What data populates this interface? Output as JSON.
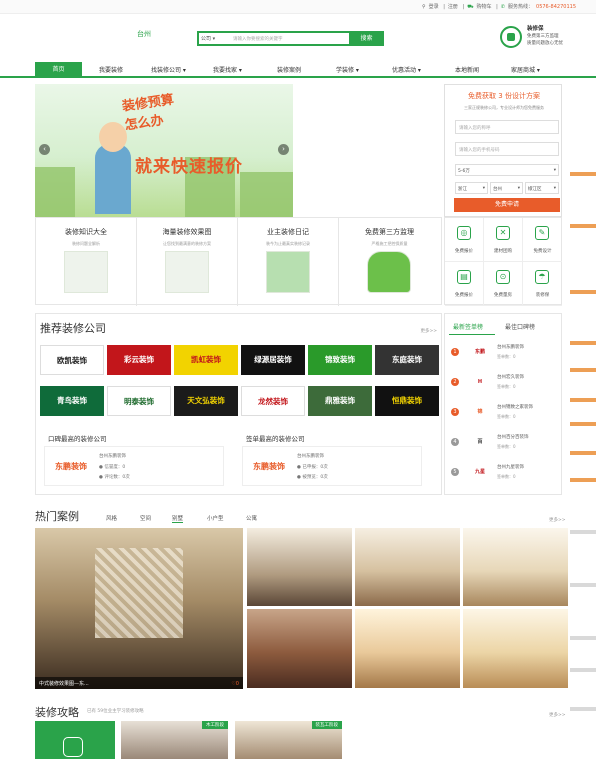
{
  "topbar": {
    "login": "登录",
    "register": "注册",
    "cart": "购物车",
    "hotline_label": "服务热线：",
    "phone": "0576-84270115"
  },
  "header": {
    "city": "台州",
    "search": {
      "scope": "公司",
      "placeholder": "请输入你要搜索的关键字",
      "button": "搜索"
    },
    "guarantee": {
      "title": "装修保",
      "line1": "免费第三方监理",
      "line2": "质量问题放心无忧"
    }
  },
  "nav": {
    "items": [
      "首页",
      "我要装修",
      "找装修公司",
      "我要找家",
      "装修案例",
      "学装修",
      "优惠活动",
      "本地新闻",
      "家居商城"
    ]
  },
  "banner": {
    "line1": "装修预算",
    "line2": "怎么办",
    "headline": "就来快速报价",
    "prev": "‹",
    "next": "›"
  },
  "quote_form": {
    "title": "免费获取 3 份设计方案",
    "subtitle": "三家正规装修公司，专业设计师为您免费服务",
    "name_ph": "请输入您的称呼",
    "phone_ph": "请输入您的手机号码",
    "area": "5-6万",
    "province": "浙江",
    "city": "台州",
    "district": "椒江区",
    "button": "免费申请"
  },
  "features": [
    {
      "title": "装修知识大全",
      "sub": "装修问题全解析"
    },
    {
      "title": "海量装修效果图",
      "sub": "让您找到最满意的装修方案"
    },
    {
      "title": "业主装修日记",
      "sub": "装今为止最真实装修记录"
    },
    {
      "title": "免费第三方监理",
      "sub": "严格施工把控保质量"
    }
  ],
  "tools": [
    {
      "label": "免费报价",
      "icon": "▢"
    },
    {
      "label": "建材团购",
      "icon": "▢"
    },
    {
      "label": "免费设计",
      "icon": "▢"
    },
    {
      "label": "免费报价",
      "icon": "▢"
    },
    {
      "label": "免费量房",
      "icon": "▢"
    },
    {
      "label": "装修保",
      "icon": "▢"
    }
  ],
  "recommend": {
    "title": "推荐装修公司",
    "more": "更多>>",
    "logos": [
      "欧凯装饰",
      "彩云装饰",
      "凯虹装饰",
      "绿源居装饰",
      "锦致装饰",
      "东庭装饰",
      "青鸟装饰",
      "明泰装饰",
      "天文弘装饰",
      "龙然装饰",
      "鼎雅装饰",
      "恒鼎装饰"
    ],
    "praise_title": "口碑最高的装修公司",
    "orders_title": "签单最高的装修公司",
    "praise": {
      "logo": "东鹏装饰",
      "name": "台州东鹏装饰",
      "l1": "● 信誉度：0",
      "l2": "● 评论数：0次"
    },
    "orders": {
      "logo": "东鹏装饰",
      "name": "台州东鹏装饰",
      "l1": "● 已申报：0次",
      "l2": "● 被预览：0次"
    }
  },
  "ranking": {
    "tab1": "最新签单榜",
    "tab2": "最佳口碑榜",
    "rows": [
      {
        "num": "1",
        "logo": "东鹏",
        "name": "台州东鹏装饰",
        "sub": "签单数：0"
      },
      {
        "num": "2",
        "logo": "H",
        "name": "台州宏久装饰",
        "sub": "签单数：0"
      },
      {
        "num": "3",
        "logo": "锦",
        "name": "台州锦致之家装饰",
        "sub": "签单数：0"
      },
      {
        "num": "4",
        "logo": "百",
        "name": "台州百分百装饰",
        "sub": "签单数：0"
      },
      {
        "num": "5",
        "logo": "九星",
        "name": "台州九星装饰",
        "sub": "签单数：0"
      }
    ]
  },
  "cases": {
    "title": "热门案例",
    "tabs": [
      "风格",
      "空间",
      "别墅",
      "小户型",
      "公寓"
    ],
    "more": "更多>>",
    "caption": "中式装修效果图—东...",
    "likes": "♡0"
  },
  "guide": {
    "title": "装修攻略",
    "sub": "已有 59位业主学习装修攻略",
    "more": "更多>>",
    "tag1": "木工阶段",
    "tag2": "装瓦工阶段"
  },
  "colors": {
    "green": "#2aa34a",
    "orange": "#e85c2a"
  }
}
